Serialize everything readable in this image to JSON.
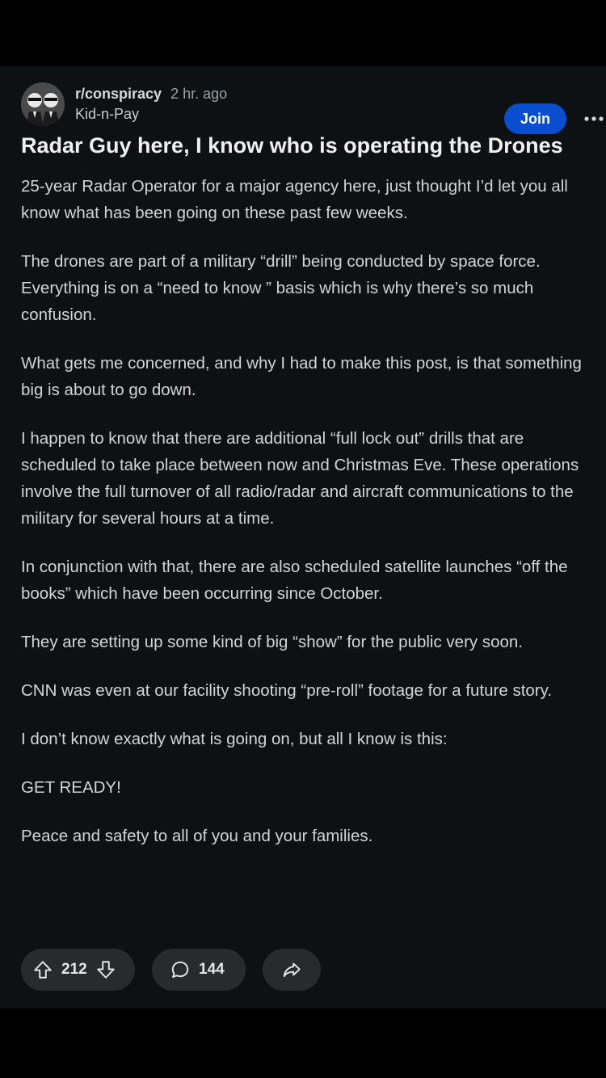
{
  "post": {
    "subreddit": "r/conspiracy",
    "time": "2 hr. ago",
    "author": "Kid-n-Pay",
    "join_label": "Join",
    "title": "Radar Guy here, I know who is operating the Drones",
    "paragraphs": [
      "25-year Radar Operator for a major agency here, just thought I’d let you all know what has been going on these past few weeks.",
      "The drones are part of a military “drill” being conducted by space force. Everything is on a “need to know ” basis which is why there’s so much confusion.",
      "What gets me concerned, and why I had to make this post, is that something big is about to go down.",
      "I happen to know that there are additional “full lock out” drills that are scheduled to take place between now and Christmas Eve. These operations involve the full turnover of all radio/radar and aircraft communications to the military for several hours at a time.",
      "In conjunction with that, there are also scheduled satellite launches “off the books” which have been occurring since October.",
      "They are setting up some kind of big “show” for the public very soon.",
      "CNN was even at our facility shooting “pre-roll” footage for a future story.",
      "I don’t know exactly what is going on, but all I know is this:",
      "GET READY!",
      "Peace and safety to all of you and your families."
    ],
    "upvotes": "212",
    "comments": "144"
  },
  "icons": {
    "avatar": "subreddit-avatar",
    "more": "more-options-icon",
    "upvote": "upvote-arrow-icon",
    "downvote": "downvote-arrow-icon",
    "comment": "comment-bubble-icon",
    "share": "share-arrow-icon"
  },
  "colors": {
    "background": "#000000",
    "post_background": "#0e1113",
    "join_button": "#0a4ed0",
    "action_pill": "#272b2e"
  }
}
